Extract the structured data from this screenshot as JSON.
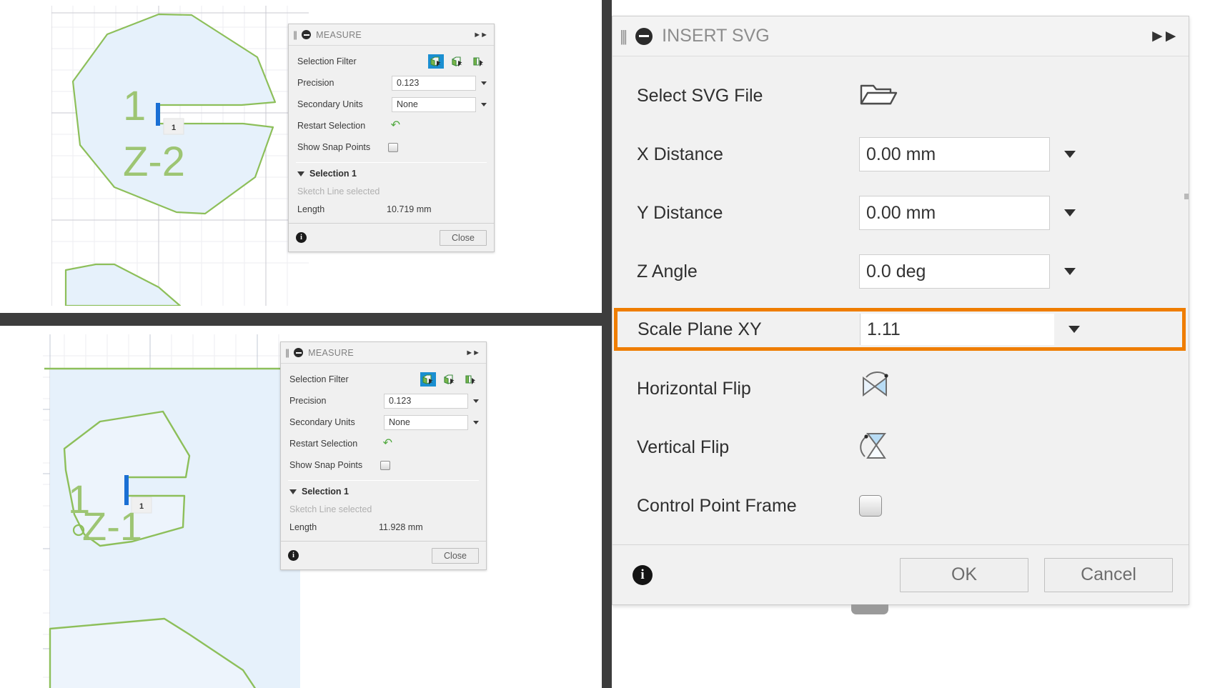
{
  "app": {
    "accent_orange": "#ef7d00",
    "accent_blue": "#1a8fd1",
    "sketch_green": "#8dbf5a",
    "selected_edge_blue": "#1a6fd4"
  },
  "measure_top": {
    "title": "MEASURE",
    "grip_icon": "drag-grip-icon",
    "collapse_icon": "minus-circle-icon",
    "expand_icon": "double-chevron-right-icon",
    "rows": [
      {
        "label": "Selection Filter",
        "type": "icon-group"
      },
      {
        "label": "Precision",
        "type": "dropdown",
        "value": "0.123"
      },
      {
        "label": "Secondary Units",
        "type": "dropdown",
        "value": "None"
      },
      {
        "label": "Restart Selection",
        "type": "icon",
        "icon": "undo-arrow-icon"
      },
      {
        "label": "Show Snap Points",
        "type": "checkbox",
        "checked": false
      }
    ],
    "filters": [
      {
        "name": "filter-solid-face",
        "selected": true
      },
      {
        "name": "filter-solid-edge",
        "selected": false
      },
      {
        "name": "filter-solid-vertex",
        "selected": false
      }
    ],
    "section": {
      "header": "Selection 1",
      "status": "Sketch Line selected",
      "metric_label": "Length",
      "metric_value": "10.719 mm"
    },
    "footer": {
      "info_icon": "info-icon",
      "close_label": "Close"
    },
    "sketch_label_number": "1",
    "sketch_label_plane": "Z-2",
    "dimension_tag": "1"
  },
  "measure_bottom": {
    "title": "MEASURE",
    "grip_icon": "drag-grip-icon",
    "collapse_icon": "minus-circle-icon",
    "expand_icon": "double-chevron-right-icon",
    "rows": [
      {
        "label": "Selection Filter",
        "type": "icon-group"
      },
      {
        "label": "Precision",
        "type": "dropdown",
        "value": "0.123"
      },
      {
        "label": "Secondary Units",
        "type": "dropdown",
        "value": "None"
      },
      {
        "label": "Restart Selection",
        "type": "icon",
        "icon": "undo-arrow-icon"
      },
      {
        "label": "Show Snap Points",
        "type": "checkbox",
        "checked": false
      }
    ],
    "filters": [
      {
        "name": "filter-solid-face",
        "selected": true
      },
      {
        "name": "filter-solid-edge",
        "selected": false
      },
      {
        "name": "filter-solid-vertex",
        "selected": false
      }
    ],
    "section": {
      "header": "Selection 1",
      "status": "Sketch Line selected",
      "metric_label": "Length",
      "metric_value": "11.928 mm"
    },
    "footer": {
      "info_icon": "info-icon",
      "close_label": "Close"
    },
    "sketch_label_number": "1",
    "sketch_label_plane": "Z-1",
    "dimension_tag": "1"
  },
  "insert_svg": {
    "title": "INSERT SVG",
    "grip_icon": "drag-grip-icon",
    "collapse_icon": "minus-circle-icon",
    "expand_icon": "double-chevron-right-icon",
    "fields": [
      {
        "label": "Select SVG File",
        "type": "file",
        "icon": "open-folder-icon"
      },
      {
        "label": "X Distance",
        "type": "dropdown-input",
        "value": "0.00 mm"
      },
      {
        "label": "Y Distance",
        "type": "dropdown-input",
        "value": "0.00 mm"
      },
      {
        "label": "Z Angle",
        "type": "dropdown-input",
        "value": "0.0 deg"
      },
      {
        "label": "Scale Plane XY",
        "type": "dropdown-input",
        "value": "1.11",
        "highlighted": true
      },
      {
        "label": "Horizontal Flip",
        "type": "toggle-icon",
        "icon": "horizontal-flip-icon"
      },
      {
        "label": "Vertical Flip",
        "type": "toggle-icon",
        "icon": "vertical-flip-icon"
      },
      {
        "label": "Control Point Frame",
        "type": "checkbox",
        "checked": false
      }
    ],
    "footer": {
      "info_icon": "info-icon",
      "ok_label": "OK",
      "cancel_label": "Cancel"
    }
  }
}
